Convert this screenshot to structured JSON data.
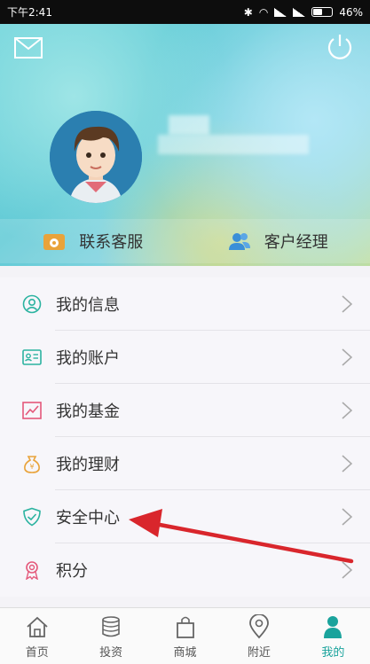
{
  "status_bar": {
    "time": "下午2:41",
    "battery": "46%"
  },
  "header": {
    "contact_service": "联系客服",
    "account_manager": "客户经理"
  },
  "menu": [
    {
      "label": "我的信息",
      "icon": "user-circle-icon",
      "color": "#2bb3a0"
    },
    {
      "label": "我的账户",
      "icon": "id-card-icon",
      "color": "#2bb3a0"
    },
    {
      "label": "我的基金",
      "icon": "trend-chart-icon",
      "color": "#e4587a"
    },
    {
      "label": "我的理财",
      "icon": "money-bag-icon",
      "color": "#e9a33a"
    },
    {
      "label": "安全中心",
      "icon": "shield-check-icon",
      "color": "#2bb3a0"
    },
    {
      "label": "积分",
      "icon": "award-ribbon-icon",
      "color": "#e4587a"
    }
  ],
  "tabs": [
    {
      "label": "首页",
      "icon": "home-icon",
      "active": false
    },
    {
      "label": "投资",
      "icon": "coins-icon",
      "active": false
    },
    {
      "label": "商城",
      "icon": "shopping-bag-icon",
      "active": false
    },
    {
      "label": "附近",
      "icon": "location-pin-icon",
      "active": false
    },
    {
      "label": "我的",
      "icon": "person-icon",
      "active": true
    }
  ],
  "colors": {
    "accent": "#1aa39c",
    "annotation": "#d9262c"
  }
}
